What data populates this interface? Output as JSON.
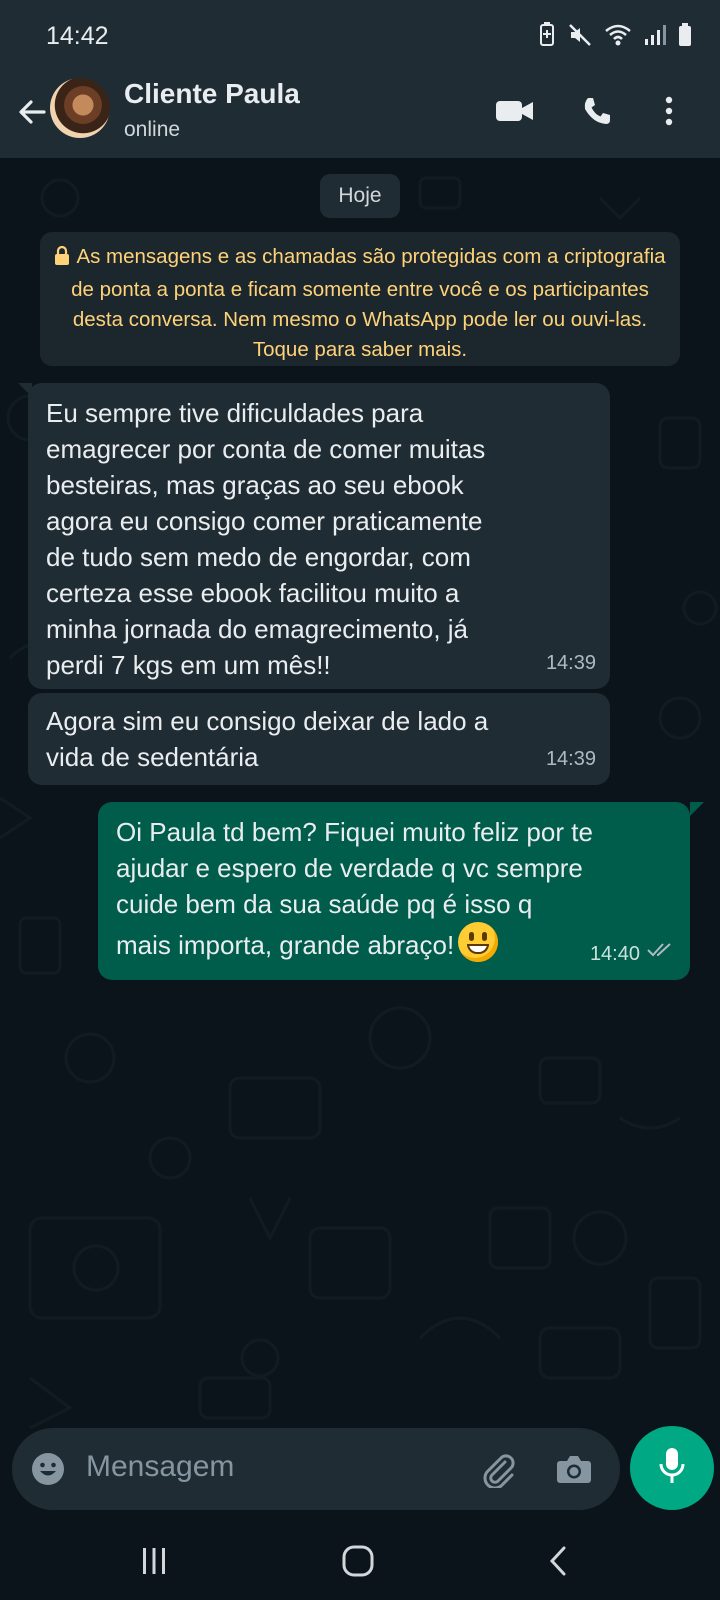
{
  "status_bar": {
    "time": "14:42",
    "icons": [
      "battery-saver-icon",
      "mute-icon",
      "wifi-icon",
      "signal-icon",
      "battery-icon"
    ]
  },
  "header": {
    "contact_name": "Cliente Paula",
    "contact_status": "online",
    "icons": [
      "back-arrow-icon",
      "video-call-icon",
      "voice-call-icon",
      "more-options-icon"
    ]
  },
  "chat": {
    "date_label": "Hoje",
    "encryption_notice": "As mensagens e as chamadas são protegidas com a criptografia de ponta a ponta e ficam somente entre você e os participantes desta conversa. Nem mesmo o WhatsApp pode ler ou ouvi-las. Toque para saber mais.",
    "messages": [
      {
        "direction": "incoming",
        "text": "Eu sempre tive dificuldades para\nemagrecer por conta de comer muitas\nbesteiras, mas graças ao seu ebook\nagora eu consigo comer praticamente\nde tudo sem medo de engordar, com\ncerteza esse ebook facilitou muito a\nminha jornada do emagrecimento, já\nperdi 7 kgs em um mês!!",
        "time": "14:39"
      },
      {
        "direction": "incoming",
        "text": "Agora sim eu consigo deixar de lado a\nvida de sedentária",
        "time": "14:39"
      },
      {
        "direction": "outgoing",
        "text": "Oi Paula td bem? Fiquei muito feliz por te\najudar e espero de verdade q vc sempre\ncuide bem da sua saúde pq é isso q\nmais importa, grande abraço!",
        "emoji": "grinning-face-emoji",
        "time": "14:40",
        "status": "read"
      }
    ]
  },
  "composer": {
    "placeholder": "Mensagem",
    "icons": [
      "emoji-icon",
      "attach-icon",
      "camera-icon",
      "mic-icon"
    ]
  },
  "colors": {
    "header_bg": "#1f2c34",
    "chat_bg": "#0b141a",
    "incoming_bubble": "#202c33",
    "outgoing_bubble": "#005c4b",
    "accent": "#00a884",
    "notice_text": "#ffd279"
  }
}
